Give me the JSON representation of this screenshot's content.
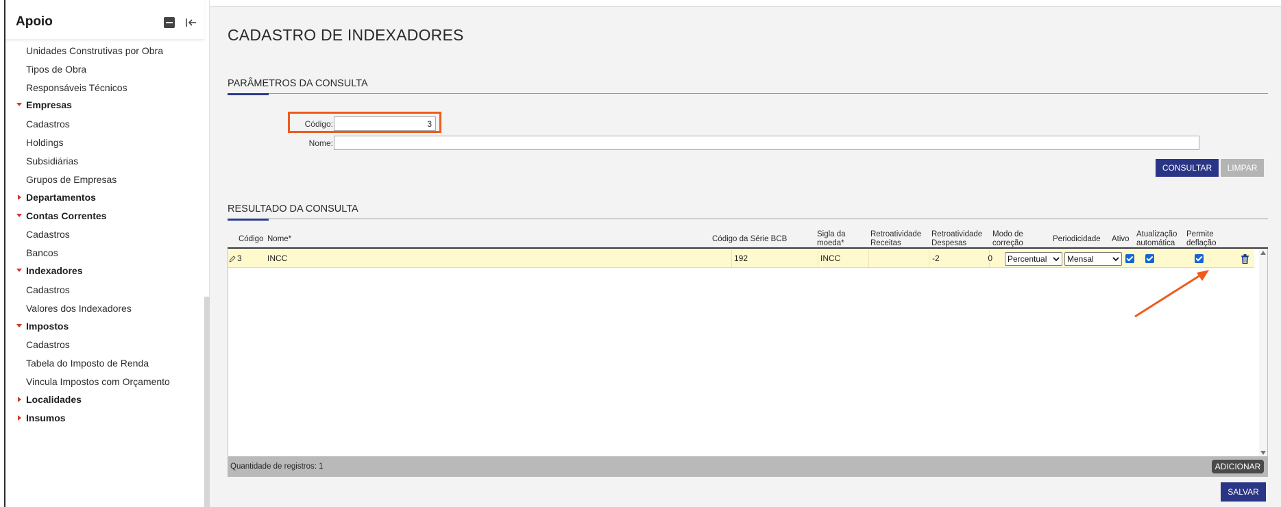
{
  "sidebar": {
    "title": "Apoio",
    "items": [
      {
        "label": "Unidades Construtivas por Obra",
        "kind": "item"
      },
      {
        "label": "Tipos de Obra",
        "kind": "item"
      },
      {
        "label": "Responsáveis Técnicos",
        "kind": "item"
      },
      {
        "label": "Empresas",
        "kind": "group",
        "expanded": true
      },
      {
        "label": "Cadastros",
        "kind": "item"
      },
      {
        "label": "Holdings",
        "kind": "item"
      },
      {
        "label": "Subsidiárias",
        "kind": "item"
      },
      {
        "label": "Grupos de Empresas",
        "kind": "item"
      },
      {
        "label": "Departamentos",
        "kind": "group",
        "expanded": false
      },
      {
        "label": "Contas Correntes",
        "kind": "group",
        "expanded": true
      },
      {
        "label": "Cadastros",
        "kind": "item"
      },
      {
        "label": "Bancos",
        "kind": "item"
      },
      {
        "label": "Indexadores",
        "kind": "group",
        "expanded": true
      },
      {
        "label": "Cadastros",
        "kind": "item"
      },
      {
        "label": "Valores dos Indexadores",
        "kind": "item"
      },
      {
        "label": "Impostos",
        "kind": "group",
        "expanded": true
      },
      {
        "label": "Cadastros",
        "kind": "item"
      },
      {
        "label": "Tabela do Imposto de Renda",
        "kind": "item"
      },
      {
        "label": "Vincula Impostos com Orçamento",
        "kind": "item"
      },
      {
        "label": "Localidades",
        "kind": "group",
        "expanded": false
      },
      {
        "label": "Insumos",
        "kind": "group",
        "expanded": false
      }
    ]
  },
  "page": {
    "title": "CADASTRO DE INDEXADORES"
  },
  "params": {
    "section_title": "PARÂMETROS DA CONSULTA",
    "codigo_label": "Código:",
    "codigo_value": "3",
    "nome_label": "Nome:",
    "nome_value": "",
    "consultar_label": "CONSULTAR",
    "limpar_label": "LIMPAR"
  },
  "results": {
    "section_title": "RESULTADO DA CONSULTA",
    "columns": {
      "codigo": "Código",
      "nome": "Nome*",
      "serie_bcb": "Código da Série BCB",
      "sigla_l1": "Sigla da",
      "sigla_l2": "moeda*",
      "retro_rec_l1": "Retroatividade",
      "retro_rec_l2": "Receitas",
      "retro_desp_l1": "Retroatividade",
      "retro_desp_l2": "Despesas",
      "modo_l1": "Modo de",
      "modo_l2": "correção",
      "periodicidade": "Periodicidade",
      "ativo": "Ativo",
      "atualizacao_l1": "Atualização",
      "atualizacao_l2": "automática",
      "deflacao_l1": "Permite",
      "deflacao_l2": "deflação"
    },
    "row": {
      "codigo": "3",
      "nome": "INCC",
      "serie_bcb": "192",
      "sigla": "INCC",
      "retro_receitas": "",
      "retro_despesas": "-2",
      "modo_num": "0",
      "modo_correcao": "Percentual",
      "periodicidade": "Mensal",
      "ativo": true,
      "atualizacao_automatica": true,
      "permite_deflacao": true
    },
    "footer_label": "Quantidade de registros:",
    "footer_count": "1",
    "adicionar_label": "ADICIONAR"
  },
  "salvar_label": "SALVAR",
  "colors": {
    "primary": "#2a3585",
    "highlight": "#f05a1a",
    "row_bg": "#fffacd",
    "checkbox": "#1565d8",
    "caret": "#d8332a"
  }
}
